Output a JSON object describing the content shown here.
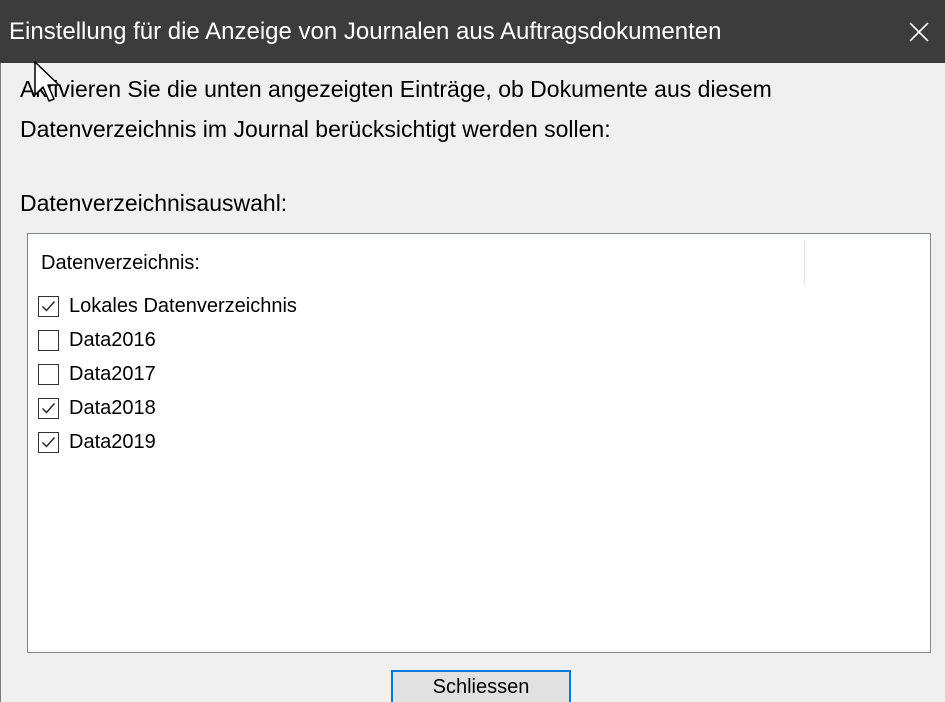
{
  "window": {
    "title": "Einstellung für die Anzeige von Journalen aus Auftragsdokumenten",
    "close_icon": "close-icon",
    "titlebar_color": "#3c3c3c",
    "accent_color": "#0078d7"
  },
  "intro": {
    "line1": "Aktivieren Sie die unten angezeigten Einträge, ob Dokumente aus diesem",
    "line2": "Datenverzeichnis im Journal berücksichtigt werden sollen:"
  },
  "section_label": "Datenverzeichnisauswahl:",
  "list": {
    "column_header": "Datenverzeichnis:",
    "items": [
      {
        "label": "Lokales Datenverzeichnis",
        "checked": true
      },
      {
        "label": "Data2016",
        "checked": false
      },
      {
        "label": "Data2017",
        "checked": false
      },
      {
        "label": "Data2018",
        "checked": true
      },
      {
        "label": "Data2019",
        "checked": true
      }
    ]
  },
  "buttons": {
    "close_label": "Schliessen"
  },
  "cursor_icon": "arrow-cursor-icon"
}
